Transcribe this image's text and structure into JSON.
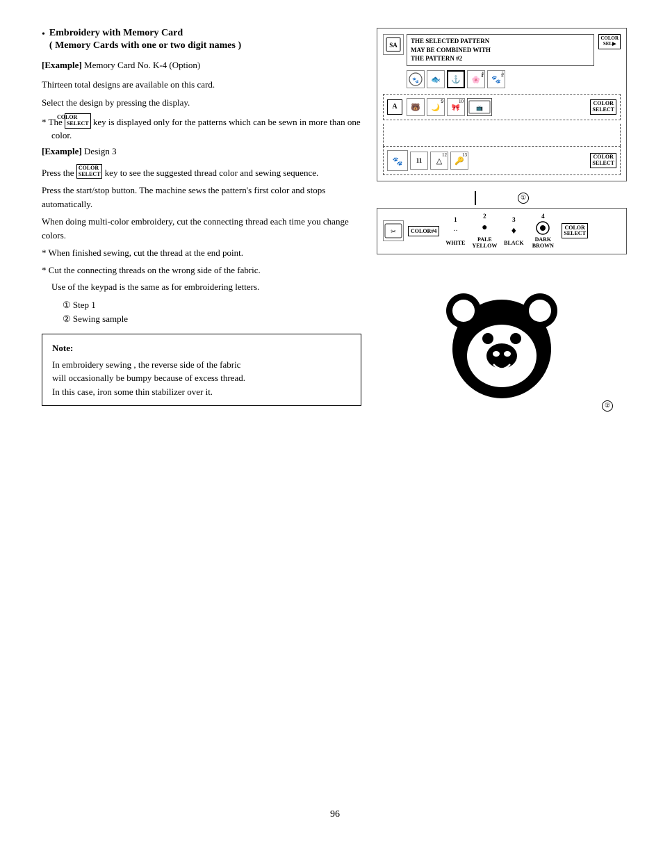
{
  "page": {
    "number": "96"
  },
  "left": {
    "bullet_title": "Embroidery with Memory Card",
    "bullet_subtitle": "( Memory Cards with one or two digit names )",
    "example1": {
      "label": "[Example]",
      "text": "  Memory Card No. K-4 (Option)"
    },
    "line1": "Thirteen total designs are available on this card.",
    "line2": "Select the design by pressing the display.",
    "asterisk1": "* The",
    "asterisk1b": " key is displayed only for the patterns which can be sewn in more than one color.",
    "example2": {
      "label": "[Example]",
      "text": "  Design 3"
    },
    "line3": "Press the",
    "line3b": " key to see the suggested thread color and sewing sequence.",
    "line4": "Press the start/stop button.  The machine sews the pattern's first color and stops automatically.",
    "line5": "When doing multi-color embroidery, cut the connecting thread each time you change colors.",
    "asterisk2": "* When finished sewing, cut the thread at the end point.",
    "asterisk3": "* Cut the connecting threads on the wrong side of the fabric.",
    "line6": "Use of the keypad is the same as for embroidering letters.",
    "step1_prefix": "① ",
    "step1": "Step 1",
    "step2_prefix": "② ",
    "step2": "Sewing sample",
    "note": {
      "title": "Note:",
      "line1": "In embroidery sewing , the reverse side of the fabric",
      "line2": "will occasionally be bumpy because of excess thread.",
      "line3": "In this case, iron some thin stabilizer over it."
    }
  },
  "right": {
    "top_panel": {
      "selected_text_line1": "THE SELECTED PATTERN",
      "selected_text_line2": "MAY BE COMBINED WITH",
      "selected_text_line3": "THE PATTERN #2",
      "color_select": "COLOR\nSEL▶"
    },
    "panel1_color_select": "COLOR\nSELECT",
    "panel2_color_select": "COLOR\nSELECT",
    "panel3_color_select": "COLOR\nSELECT",
    "circle1": "①",
    "color_panel": {
      "color_num": "COLOR#4",
      "colors": [
        {
          "num": "1",
          "name": "WHITE",
          "symbol": "··"
        },
        {
          "num": "2",
          "name": "PALE\nYELLOW",
          "symbol": "●"
        },
        {
          "num": "3",
          "name": "BLACK",
          "symbol": "♦"
        },
        {
          "num": "4",
          "name": "DARK\nBROWN",
          "symbol": "⊙"
        }
      ],
      "color_select": "COLOR\nSELECT"
    },
    "circle2": "②",
    "bear_caption": "②"
  }
}
